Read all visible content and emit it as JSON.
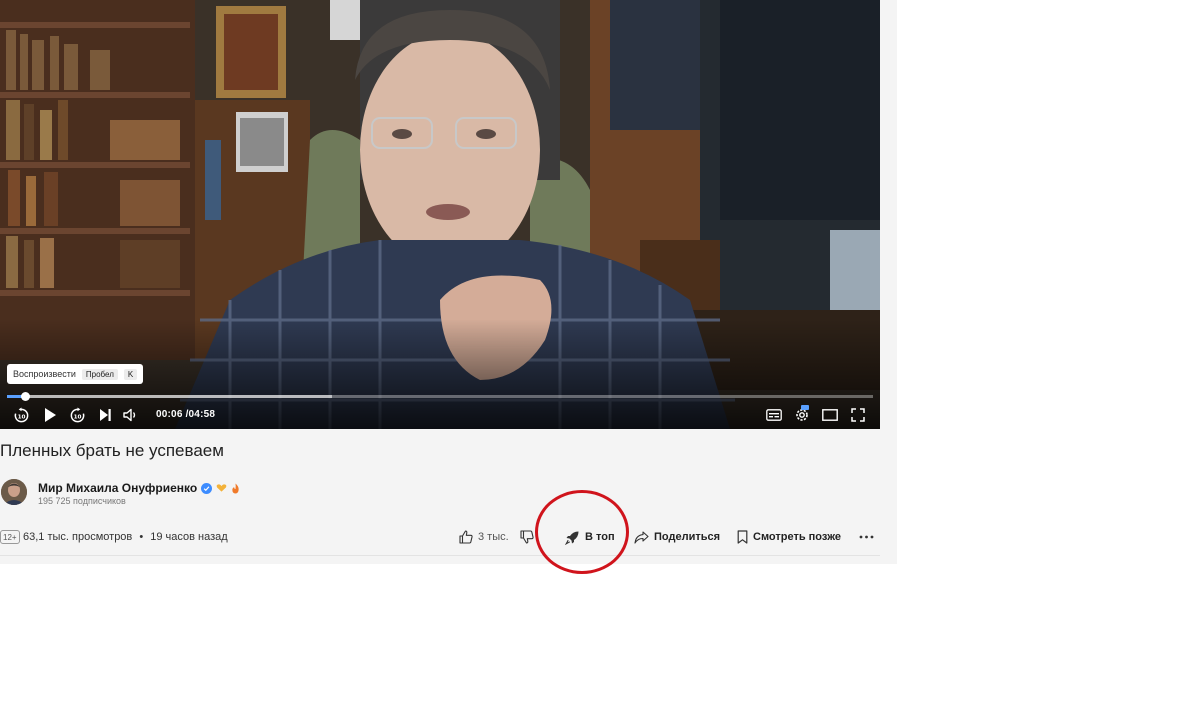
{
  "player": {
    "tooltip_action": "Воспроизвести",
    "tooltip_keys": [
      "Пробел",
      "K"
    ],
    "current_time": "00:06",
    "duration": "04:58",
    "played_fraction": 0.021,
    "buffered_fraction": 0.375,
    "rewind_seconds": "10",
    "forward_seconds": "10"
  },
  "video": {
    "title": "Пленных брать не успеваем"
  },
  "channel": {
    "name": "Мир Михаила Онуфриенко",
    "subscribers": "195 725 подписчиков"
  },
  "stats": {
    "age_rating": "12+",
    "views": "63,1 тыс. просмотров",
    "separator": "•",
    "published": "19 часов назад"
  },
  "actions": {
    "like_count": "3 тыс.",
    "boost_label": "В топ",
    "share_label": "Поделиться",
    "watch_later_label": "Смотреть позже"
  },
  "colors": {
    "accent": "#5aa0ff",
    "verified": "#3d8cff",
    "annotation_circle": "#d0141c"
  }
}
